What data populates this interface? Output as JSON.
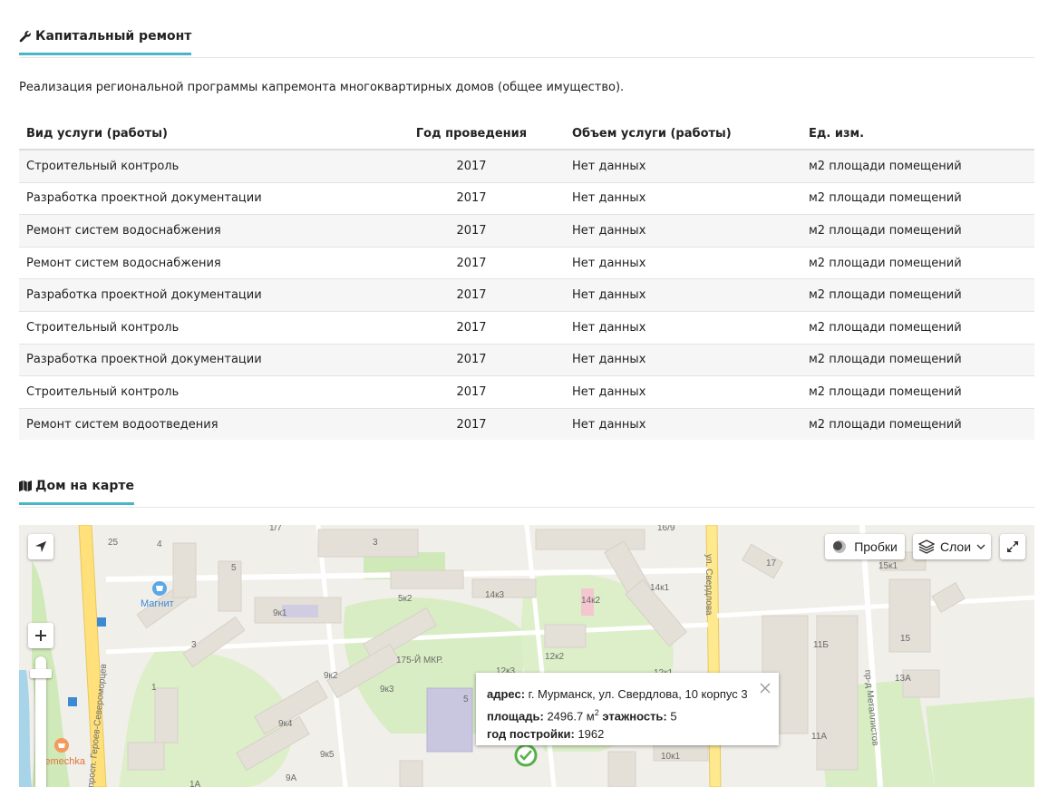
{
  "capital_repair": {
    "title": "Капитальный ремонт",
    "intro": "Реализация региональной программы капремонта многоквартирных домов (общее имущество).",
    "columns": [
      "Вид услуги (работы)",
      "Год проведения",
      "Объем услуги (работы)",
      "Ед. изм."
    ],
    "rows": [
      [
        "Строительный контроль",
        "2017",
        "Нет данных",
        "м2 площади помещений"
      ],
      [
        "Разработка проектной документации",
        "2017",
        "Нет данных",
        "м2 площади помещений"
      ],
      [
        "Ремонт систем водоснабжения",
        "2017",
        "Нет данных",
        "м2 площади помещений"
      ],
      [
        "Ремонт систем водоснабжения",
        "2017",
        "Нет данных",
        "м2 площади помещений"
      ],
      [
        "Разработка проектной документации",
        "2017",
        "Нет данных",
        "м2 площади помещений"
      ],
      [
        "Строительный контроль",
        "2017",
        "Нет данных",
        "м2 площади помещений"
      ],
      [
        "Разработка проектной документации",
        "2017",
        "Нет данных",
        "м2 площади помещений"
      ],
      [
        "Строительный контроль",
        "2017",
        "Нет данных",
        "м2 площади помещений"
      ],
      [
        "Ремонт систем водоотведения",
        "2017",
        "Нет данных",
        "м2 площади помещений"
      ]
    ]
  },
  "map_section": {
    "title": "Дом на карте",
    "controls": {
      "traffic_label": "Пробки",
      "layers_label": "Слои"
    },
    "popup": {
      "address_label": "адрес:",
      "address_value": "г. Мурманск, ул. Свердлова, 10 корпус 3",
      "area_label": "площадь:",
      "area_value": "2496.7 м",
      "area_unit_sup": "2",
      "floors_label": "этажность:",
      "floors_value": "5",
      "year_label": "год постройки:",
      "year_value": "1962"
    },
    "labels": {
      "street_left": "просп. Героев-Североморцев",
      "street_sverdlova": "ул. Свердлова",
      "street_metallistov": "пр-д Металлистов",
      "district": "175-Й МКР.",
      "poi_magnit": "Магнит",
      "poi_semechka": "Semechka",
      "h1": "25",
      "h2": "4",
      "h3": "1/7",
      "h4": "3",
      "h5": "16/9",
      "h6": "17",
      "h7": "15к1",
      "h8": "5",
      "h9": "5к2",
      "h10": "14к3",
      "h11": "14к2",
      "h12": "14к1",
      "h13": "9к1",
      "h14": "3",
      "h15": "12к2",
      "h16": "11Б",
      "h17": "15",
      "h18": "13А",
      "h19": "9к2",
      "h20": "9к3",
      "h21": "12к3",
      "h22": "12к1",
      "h23": "1",
      "h24": "9к4",
      "h25": "11А",
      "h26": "9к5",
      "h27": "10к1",
      "h28": "9А",
      "h29": "1А",
      "h30": "5"
    }
  }
}
